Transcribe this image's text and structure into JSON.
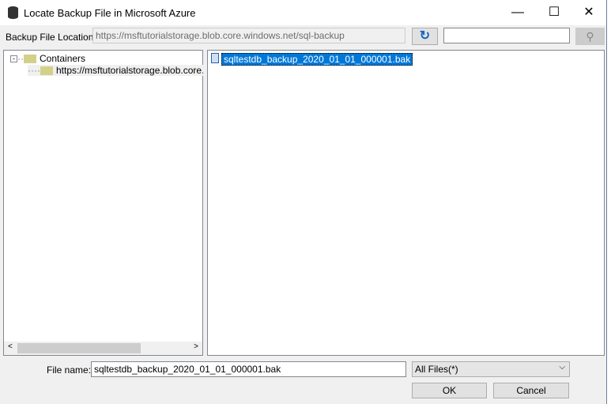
{
  "window": {
    "title": "Locate Backup File in Microsoft Azure",
    "minimize": "—",
    "maximize": "☐",
    "close": "✕"
  },
  "location": {
    "label": "Backup File Location",
    "value": "https://msftutorialstorage.blob.core.windows.net/sql-backup"
  },
  "search": {
    "value": ""
  },
  "tree": {
    "root": "Containers",
    "child": "https://msftutorialstorage.blob.core.windows.net/sql-backup"
  },
  "files": [
    {
      "name": "sqltestdb_backup_2020_01_01_000001.bak",
      "selected": true
    }
  ],
  "footer": {
    "filename_label": "File name:",
    "filename_value": "sqltestdb_backup_2020_01_01_000001.bak",
    "filter": "All Files(*)",
    "ok": "OK",
    "cancel": "Cancel"
  }
}
